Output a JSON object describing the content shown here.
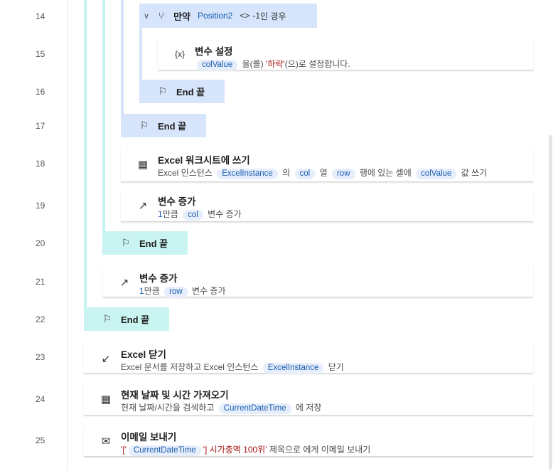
{
  "line_numbers": [
    "14",
    "15",
    "16",
    "17",
    "18",
    "19",
    "20",
    "21",
    "22",
    "23",
    "24",
    "25"
  ],
  "actions": {
    "if_block": {
      "keyword": "만약",
      "variable": "Position2",
      "operator": "<>",
      "value": "-1",
      "suffix": "인 경우"
    },
    "set_variable": {
      "title": "변수 설정",
      "var": "colValue",
      "text1": "을(를)",
      "quote_open": "'",
      "str_value": "하락",
      "quote_close": "'",
      "text2": "(으)로 설정합니다."
    },
    "end_14": "End 끝",
    "end_17": "End 끝",
    "excel_write": {
      "title": "Excel 워크시트에 쓰기",
      "text1": "Excel 인스턴스",
      "instance": "ExcelInstance",
      "text2": "의",
      "col": "col",
      "text3": "열",
      "row": "row",
      "text4": "행에 있는 셀에",
      "value": "colValue",
      "text5": "값 쓰기"
    },
    "increase_col": {
      "title": "변수 증가",
      "amount": "1",
      "text1": "만큼",
      "var": "col",
      "text2": "변수 증가"
    },
    "end_20": "End 끝",
    "increase_row": {
      "title": "변수 증가",
      "amount": "1",
      "text1": "만큼",
      "var": "row",
      "text2": "변수 증가"
    },
    "end_22": "End 끝",
    "excel_close": {
      "title": "Excel 닫기",
      "text1": "Excel 문서를 저장하고 Excel 인스턴스",
      "instance": "ExcelInstance",
      "text2": "닫기"
    },
    "get_datetime": {
      "title": "현재 날짜 및 시간 가져오기",
      "text1": "현재 날짜/시간을 검색하고",
      "var": "CurrentDateTime",
      "text2": "에 저장"
    },
    "send_email": {
      "title": "이메일 보내기",
      "part1": "'['",
      "var": "CurrentDateTime",
      "part2": "'] 시가총액 100위'",
      "text1": "제목으로 에게 이메일 보내기"
    }
  },
  "icons": {
    "chevron": "chevron-down-icon",
    "condition": "branch-icon",
    "variable": "variable-icon",
    "end": "flag-icon",
    "excel_write": "table-write-icon",
    "increase": "trend-up-icon",
    "close": "arrow-close-icon",
    "calendar": "calendar-icon",
    "mail": "mail-icon"
  },
  "colors": {
    "teal_block": "#c9f4f1",
    "blue_block": "#d6e5fb",
    "variable_chip_text": "#1a5cb0",
    "string_literal": "#a31515"
  }
}
